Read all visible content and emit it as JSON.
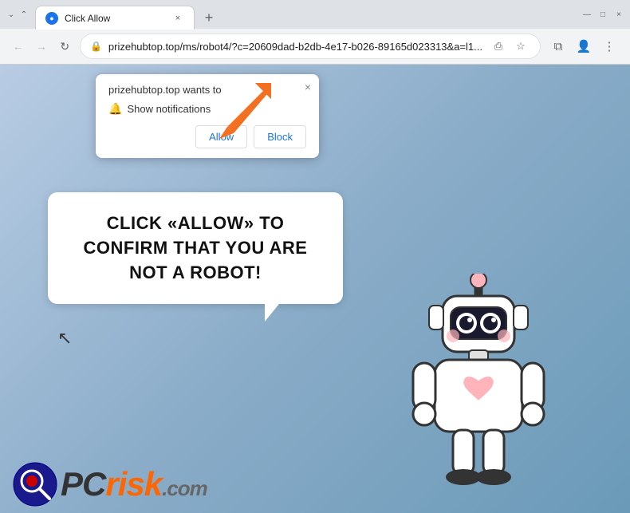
{
  "browser": {
    "tab": {
      "favicon_label": "C",
      "title": "Click Allow",
      "close_label": "×"
    },
    "new_tab_label": "+",
    "window_controls": {
      "minimize": "—",
      "maximize": "□",
      "close": "×",
      "chevron_down": "⌄",
      "chevron_up": "⌃"
    },
    "nav": {
      "back": "←",
      "forward": "→",
      "refresh": "↻"
    },
    "url": {
      "lock": "🔒",
      "text": "prizehubtop.top/ms/robot4/?c=20609dad-b2db-4e17-b026-89165d023313&a=l1...",
      "share": "⎙",
      "star": "☆",
      "extensions": "⧉",
      "account": "👤",
      "menu": "⋮"
    }
  },
  "notification_popup": {
    "header": "prizehubtop.top wants to",
    "bell_text": "Show notifications",
    "allow_label": "Allow",
    "block_label": "Block",
    "close_label": "×"
  },
  "speech_bubble": {
    "text": "CLICK «ALLOW» TO CONFIRM THAT YOU ARE NOT A ROBOT!"
  },
  "pcrisk": {
    "pc_label": "PC",
    "risk_label": "risk",
    "com_label": ".com"
  },
  "colors": {
    "orange_arrow": "#f37021",
    "blue_bg": "#7ba7c2",
    "bubble_bg": "#ffffff",
    "bubble_text": "#111111"
  }
}
